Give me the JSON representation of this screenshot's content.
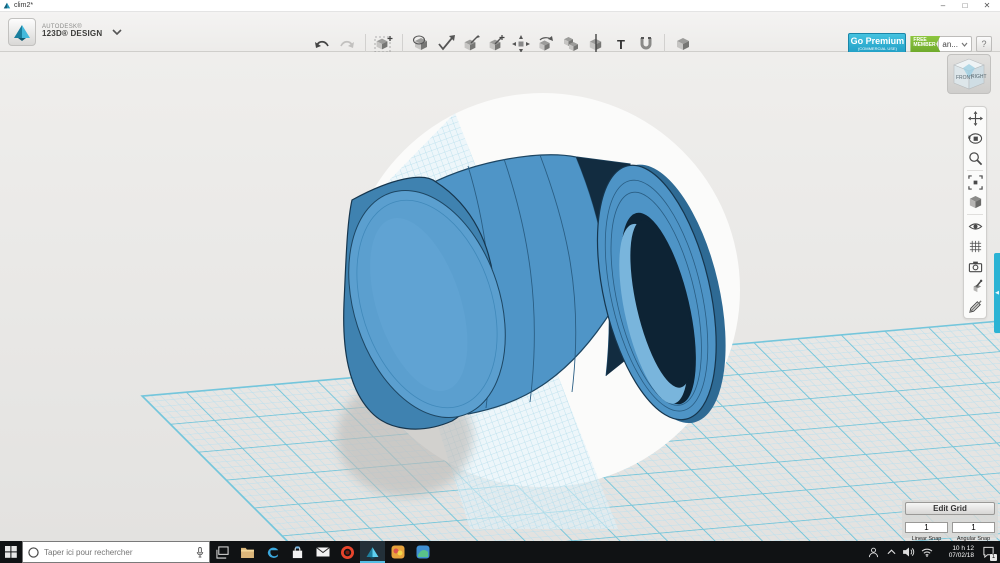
{
  "window": {
    "title": "clim2*"
  },
  "brand": {
    "company": "AUTODESK®",
    "product": "123D® DESIGN"
  },
  "toolbar": {
    "text_tool_label": "T",
    "icons": [
      "undo-icon",
      "redo-icon",
      "primitives-icon",
      "sketch-icon",
      "spline-check-icon",
      "construct-icon",
      "modify-icon",
      "pattern-icon",
      "grouping-icon",
      "combine-icon",
      "split-icon",
      "text-icon",
      "magnet-icon",
      "insert-icon"
    ]
  },
  "account": {
    "premium_label": "Go Premium",
    "premium_sub": "(COMMERCIAL USE)",
    "member_line1": "FREE",
    "member_line2": "MEMBER",
    "user_label": "an...",
    "help_label": "?"
  },
  "viewcube": {
    "front_label": "FRONT",
    "right_label": "RIGHT"
  },
  "nav_tools": [
    "pan-icon",
    "orbit-icon",
    "zoom-icon",
    "fit-icon",
    "shaded-view-icon",
    "visibility-eye-icon",
    "grid-toggle-icon",
    "screenshot-camera-icon",
    "material-icon",
    "hide-sketch-icon"
  ],
  "grid_panel": {
    "edit_button_label": "Edit Grid",
    "linear_snap_value": "1",
    "angular_snap_value": "1",
    "linear_snap_label": "Linear Snap",
    "angular_snap_label": "Angular Snap"
  },
  "taskbar": {
    "search_placeholder": "Taper ici pour rechercher",
    "icons": [
      "start-icon",
      "search-icon",
      "mic-icon",
      "task-view-icon",
      "explorer-icon",
      "edge-icon",
      "store-icon",
      "mail-icon",
      "opera-icon",
      "123d-design-icon",
      "app-icon-1",
      "app-icon-2"
    ],
    "tray": {
      "icons": [
        "people-icon",
        "chevron-up-icon",
        "volume-icon",
        "wifi-icon"
      ],
      "time": "10 h 12",
      "date": "07/02/18",
      "notification_count": "1"
    }
  },
  "colors": {
    "accent_cyan": "#2bb3d4",
    "premium_blue": "#2aa7cb",
    "member_green": "#7db93a",
    "model_blue": "#4f95c7",
    "model_dark": "#122c40",
    "grid_line": "#8fd0e2",
    "canvas_bg": "#e8e7e5",
    "taskbar_bg": "#101214"
  }
}
